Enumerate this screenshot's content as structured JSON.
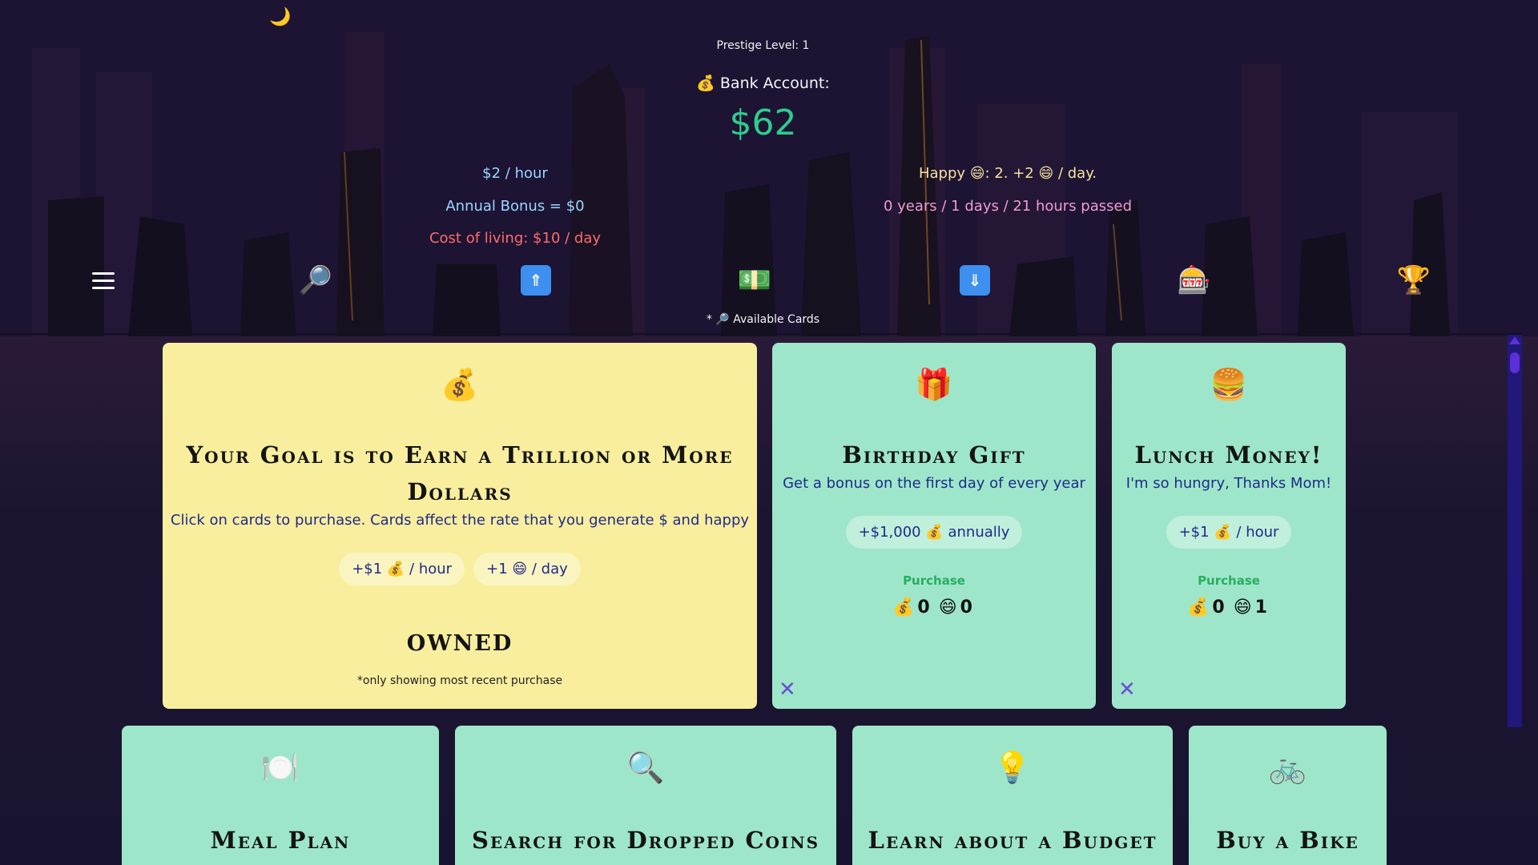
{
  "header": {
    "prestige": "Prestige Level: 1",
    "bank_label": "💰 Bank Account:",
    "bank_value": "$62",
    "rate": "$2 / hour",
    "annual_bonus": "Annual Bonus = $0",
    "cost_of_living": "Cost of living: $10 / day",
    "happy": "Happy 😄: 2.   +2 😄 / day.",
    "time_passed": "0 years / 1 days / 21 hours passed",
    "available_cards": "* 🔎 Available Cards"
  },
  "nav": {
    "icons": [
      "menu-icon",
      "search-icon",
      "upgrade-up-icon",
      "money-icon",
      "upgrade-down-icon",
      "slot-machine-icon",
      "trophy-icon"
    ],
    "search_glyph": "🔎",
    "money_glyph": "💵",
    "up_glyph": "⇑",
    "down_glyph": "⇓",
    "slot_glyph": "🎰",
    "trophy_glyph": "🏆",
    "moon_glyph": "🌙"
  },
  "cards": {
    "goal": {
      "icon": "💰",
      "title_line1": "Your Goal is to Earn a Trillion or More",
      "title_line2": "Dollars",
      "desc": "Click on cards to purchase. Cards affect the rate that you generate $ and happy",
      "pill1": "+$1 💰 / hour",
      "pill2": "+1 😄 / day",
      "owned": "OWNED",
      "note": "*only showing most recent purchase"
    },
    "birthday": {
      "icon": "🎁",
      "title": "Birthday Gift",
      "desc": "Get a bonus on the first day of every year",
      "pill": "+$1,000 💰 annually",
      "purchase": "Purchase",
      "cost_money": "0",
      "cost_happy": "0"
    },
    "lunch": {
      "icon": "🍔",
      "title": "Lunch Money!",
      "desc": "I'm so hungry, Thanks Mom!",
      "pill": "+$1 💰 / hour",
      "purchase": "Purchase",
      "cost_money": "0",
      "cost_happy": "1"
    },
    "meal": {
      "icon": "🍽️",
      "title": "Meal Plan"
    },
    "coins": {
      "icon": "🔍",
      "title": "Search for Dropped Coins"
    },
    "budget": {
      "icon": "💡",
      "title": "Learn about a Budget"
    },
    "bike": {
      "icon": "🚲",
      "title": "Buy a Bike"
    }
  },
  "glyphs": {
    "money": "💰",
    "happy": "😄",
    "close": "✕"
  },
  "colors": {
    "bank_value": "#2ecc8f",
    "card_green": "#9ee6ca",
    "card_yellow": "#f8ee9e",
    "cost_of_living": "#ff6b6b"
  }
}
